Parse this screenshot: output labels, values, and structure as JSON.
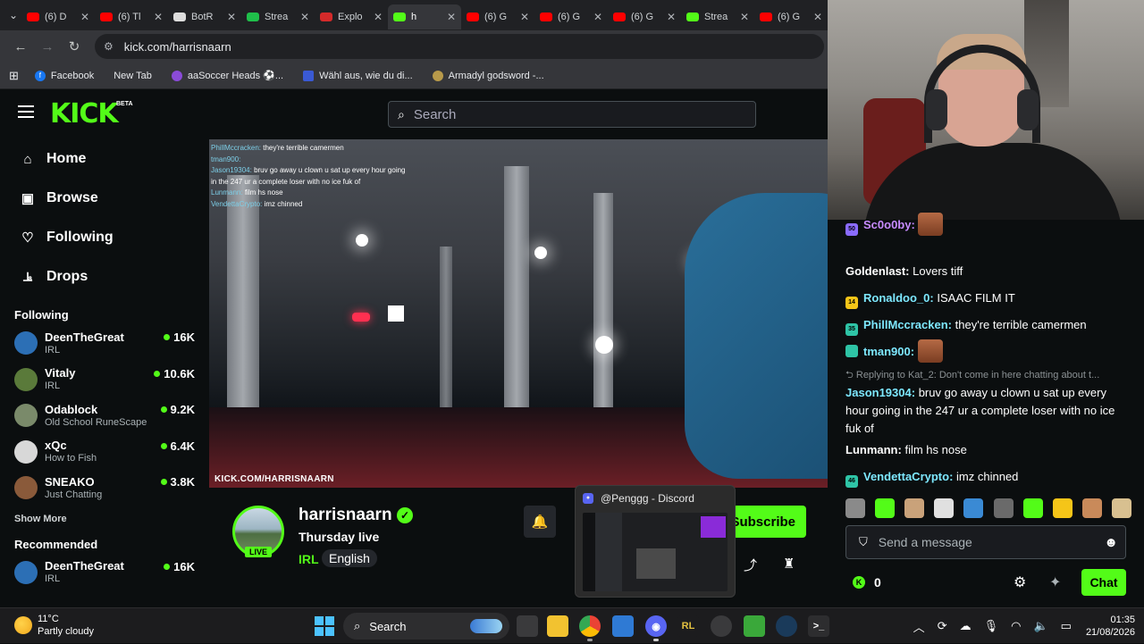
{
  "browser": {
    "tabs": [
      {
        "label": "(6) D",
        "color": "#ff0000"
      },
      {
        "label": "(6) Tl",
        "color": "#ff0000"
      },
      {
        "label": "BotR",
        "color": "#dddddd"
      },
      {
        "label": "Strea",
        "color": "#1fbf4a"
      },
      {
        "label": "Explo",
        "color": "#d42a2a"
      },
      {
        "label": "h",
        "color": "#53fc18",
        "active": true
      },
      {
        "label": "(6) G",
        "color": "#ff0000"
      },
      {
        "label": "(6) G",
        "color": "#ff0000"
      },
      {
        "label": "(6) G",
        "color": "#ff0000"
      },
      {
        "label": "Strea",
        "color": "#53fc18"
      },
      {
        "label": "(6) G",
        "color": "#ff0000"
      }
    ],
    "url": "kick.com/harrisnaarn",
    "bookmarks": [
      "Facebook",
      "New Tab",
      "aaSoccer Heads ⚽...",
      "Wähl aus, wie du di...",
      "Armadyl godsword -..."
    ]
  },
  "kick": {
    "logo": "KICK",
    "logo_badge": "BETA",
    "search_placeholder": "Search",
    "nav": [
      "Home",
      "Browse",
      "Following",
      "Drops"
    ],
    "following_heading": "Following",
    "following": [
      {
        "name": "DeenTheGreat",
        "category": "IRL",
        "viewers": "16K",
        "avatar": "#2c6fb5"
      },
      {
        "name": "Vitaly",
        "category": "IRL",
        "viewers": "10.6K",
        "avatar": "#5a7a3a"
      },
      {
        "name": "Odablock",
        "category": "Old School RuneScape",
        "viewers": "9.2K",
        "avatar": "#7a8a6a"
      },
      {
        "name": "xQc",
        "category": "How to Fish",
        "viewers": "6.4K",
        "avatar": "#d8d8d8"
      },
      {
        "name": "SNEAKO",
        "category": "Just Chatting",
        "viewers": "3.8K",
        "avatar": "#8a5a3a"
      }
    ],
    "show_more": "Show More",
    "recommended_heading": "Recommended",
    "recommended": [
      {
        "name": "DeenTheGreat",
        "category": "IRL",
        "viewers": "16K",
        "avatar": "#2c6fb5"
      }
    ]
  },
  "video": {
    "watermark": "KICK.COM/HARRISNAARN",
    "overlay_chat": [
      {
        "user": "PhillMccracken:",
        "text": "they're terrible camermen"
      },
      {
        "user": "tman900:",
        "text": ""
      },
      {
        "user": "Jason19304:",
        "text": "bruv go away u clown u sat up every hour going in the 247 ur a complete loser with no ice fuk of"
      },
      {
        "user": "Lunmann:",
        "text": "film hs nose"
      },
      {
        "user": "VendettaCrypto:",
        "text": "imz chinned"
      }
    ]
  },
  "stream": {
    "streamer": "harrisnaarn",
    "live_label": "LIVE",
    "title": "Thursday live",
    "category": "IRL",
    "language": "English",
    "subscribe_label": "Subscribe"
  },
  "discord_preview": {
    "title": "@Penggg - Discord"
  },
  "chat": {
    "messages": [
      {
        "user": "Sc0o0by:",
        "text": "",
        "color": "#c78bff",
        "badge": "#8a6bff",
        "badge_text": "50",
        "emote": true
      },
      {
        "user": "Goldenlast:",
        "text": "Lovers tiff",
        "color": "#ffffff",
        "badge": "",
        "badge_text": "",
        "emote": false
      },
      {
        "user": "Ronaldoo_0:",
        "text": "ISAAC FILM IT",
        "color": "#7de8ff",
        "badge": "#f5c518",
        "badge_text": "14",
        "emote": false
      },
      {
        "user": "PhillMccracken:",
        "text": "they're terrible camermen",
        "color": "#7de8ff",
        "badge": "#2ec4a6",
        "badge_text": "35",
        "emote": false
      },
      {
        "user": "tman900:",
        "text": "",
        "color": "#7de8ff",
        "badge": "#2ec4a6",
        "badge_text": "",
        "emote": true
      },
      {
        "user": "Jason19304:",
        "text": "bruv go away u clown u sat up every hour going in the 247 ur a complete loser with no ice fuk of",
        "color": "#7de8ff",
        "badge": "",
        "badge_text": "",
        "emote": false,
        "reply": "Replying to Kat_2: Don't come in here chatting about t..."
      },
      {
        "user": "Lunmann:",
        "text": "film hs nose",
        "color": "#ffffff",
        "badge": "",
        "badge_text": "",
        "emote": false
      },
      {
        "user": "VendettaCrypto:",
        "text": "imz chinned",
        "color": "#7de8ff",
        "badge": "#2ec4a6",
        "badge_text": "46",
        "emote": false
      }
    ],
    "emotes": [
      "#8a8a8a",
      "#53fc18",
      "#c9a27a",
      "#e0e0e0",
      "#3a8ad4",
      "#6a6a6a",
      "#53fc18",
      "#f5c518",
      "#c98a5a",
      "#d8c090"
    ],
    "input_placeholder": "Send a message",
    "points": "0",
    "send_label": "Chat"
  },
  "taskbar": {
    "temperature": "11°C",
    "weather": "Partly cloudy",
    "search_label": "Search",
    "time": "01:35",
    "date": "21/08/2026"
  }
}
